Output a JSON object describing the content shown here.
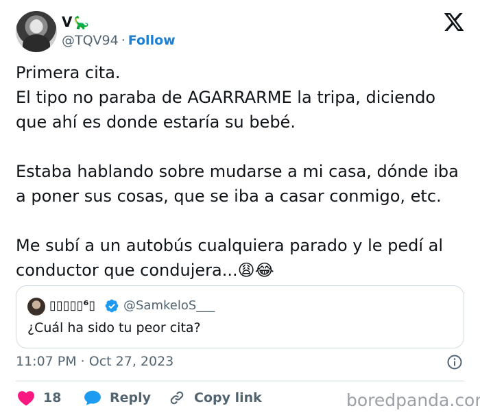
{
  "author": {
    "display_name": "V",
    "name_emoji": "🦕",
    "handle": "@TQV94",
    "separator": "·",
    "follow_label": "Follow"
  },
  "tweet": {
    "text": "Primera cita.\nEl tipo no paraba de AGARRARME la tripa, diciendo que ahí es donde estaría su bebé.\n\nEstaba hablando sobre mudarse a mi casa, dónde iba a poner sus cosas, que se iba a casar conmigo, etc.\n\nMe subí a un autobús cualquiera parado y le pedí al conductor que condujera...😩😂"
  },
  "quoted_tweet": {
    "display_name": "▯▯▯▯▯⁶▯",
    "handle": "@SamkeloS___",
    "text": "¿Cuál ha sido tu peor cita?"
  },
  "meta": {
    "timestamp": "11:07 PM · Oct 27, 2023"
  },
  "actions": {
    "likes_count": "18",
    "reply_label": "Reply",
    "copy_link_label": "Copy link"
  },
  "watermark": "boredpanda.com",
  "colors": {
    "like": "#f91880",
    "reply": "#1d9bf0",
    "follow": "#1d7fd2",
    "verified": "#1d9bf0",
    "secondary_text": "#536471"
  }
}
